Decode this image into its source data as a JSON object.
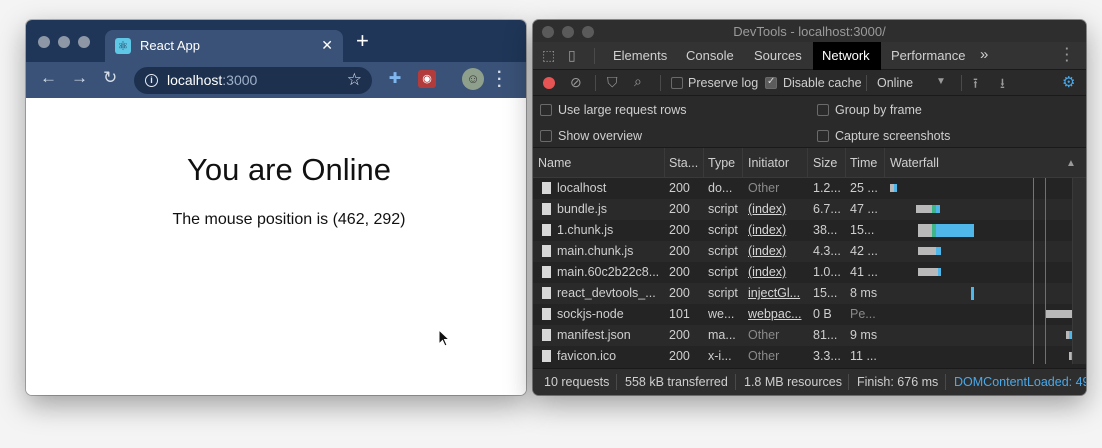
{
  "browser": {
    "tab_title": "React App",
    "tab_close": "✕",
    "new_tab": "+",
    "url_host": "localhost",
    "url_port": ":3000",
    "page": {
      "headline": "You are Online",
      "mouse_text": "The mouse position is (462, 292)"
    }
  },
  "devtools": {
    "window_title": "DevTools - localhost:3000/",
    "tabs": [
      "Elements",
      "Console",
      "Sources",
      "Network",
      "Performance"
    ],
    "active_tab": "Network",
    "more_tabs": "»",
    "controls": {
      "preserve_log": "Preserve log",
      "preserve_log_checked": false,
      "disable_cache": "Disable cache",
      "disable_cache_checked": true,
      "throttle": "Online"
    },
    "options": {
      "large_rows": "Use large request rows",
      "show_overview": "Show overview",
      "group_by_frame": "Group by frame",
      "capture_screenshots": "Capture screenshots"
    },
    "columns": [
      "Name",
      "Sta...",
      "Type",
      "Initiator",
      "Size",
      "Time",
      "Waterfall"
    ],
    "rows": [
      {
        "name": "localhost",
        "status": "200",
        "type": "do...",
        "initiator": "Other",
        "initiator_link": false,
        "size": "1.2...",
        "time": "25 ..."
      },
      {
        "name": "bundle.js",
        "status": "200",
        "type": "script",
        "initiator": "(index)",
        "initiator_link": true,
        "size": "6.7...",
        "time": "47 ..."
      },
      {
        "name": "1.chunk.js",
        "status": "200",
        "type": "script",
        "initiator": "(index)",
        "initiator_link": true,
        "size": "38...",
        "time": "15..."
      },
      {
        "name": "main.chunk.js",
        "status": "200",
        "type": "script",
        "initiator": "(index)",
        "initiator_link": true,
        "size": "4.3...",
        "time": "42 ..."
      },
      {
        "name": "main.60c2b22c8...",
        "status": "200",
        "type": "script",
        "initiator": "(index)",
        "initiator_link": true,
        "size": "1.0...",
        "time": "41 ..."
      },
      {
        "name": "react_devtools_...",
        "status": "200",
        "type": "script",
        "initiator": "injectGl...",
        "initiator_link": true,
        "size": "15...",
        "time": "8 ms"
      },
      {
        "name": "sockjs-node",
        "status": "101",
        "type": "we...",
        "initiator": "webpac...",
        "initiator_link": true,
        "size": "0 B",
        "time": "Pe..."
      },
      {
        "name": "manifest.json",
        "status": "200",
        "type": "ma...",
        "initiator": "Other",
        "initiator_link": false,
        "size": "81...",
        "time": "9 ms"
      },
      {
        "name": "favicon.ico",
        "status": "200",
        "type": "x-i...",
        "initiator": "Other",
        "initiator_link": false,
        "size": "3.3...",
        "time": "11 ..."
      }
    ],
    "status_bar": {
      "requests": "10 requests",
      "transferred": "558 kB transferred",
      "resources": "1.8 MB resources",
      "finish": "Finish: 676 ms",
      "dom_loaded": "DOMContentLoaded: 49"
    },
    "colors": {
      "dom_loaded": "#4aa8e8",
      "record": "#e65454",
      "bar_blue": "#4fb7ea",
      "bar_green": "#3fb68a",
      "bar_gray": "#b9b9b9"
    }
  }
}
